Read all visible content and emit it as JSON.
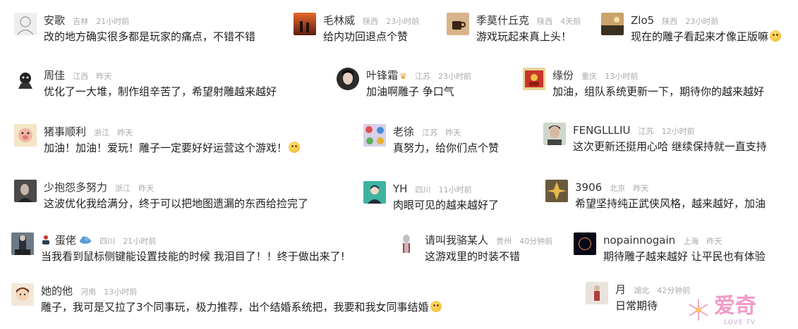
{
  "comments": [
    {
      "user": "安歌",
      "loc": "吉林",
      "time": "21小时前",
      "text": "改的地方确实很多都是玩家的痛点，不错不错",
      "avatar": "sketch-avatar"
    },
    {
      "user": "毛林威",
      "loc": "陕西",
      "time": "23小时前",
      "text": "给内功回退点个赞",
      "avatar": "sunset-couple-avatar"
    },
    {
      "user": "季莫什丘克",
      "loc": "陕西",
      "time": "4天前",
      "text": "游戏玩起来真上头！",
      "avatar": "coffee-cup-avatar"
    },
    {
      "user": "Zlo5",
      "loc": "陕西",
      "time": "23小时前",
      "text": "现在的雕子看起来才像正版嘛",
      "avatar": "landscape-avatar",
      "emoji": "wink-emoji"
    },
    {
      "user": "周佳",
      "loc": "江西",
      "time": "昨天",
      "text": "优化了一大堆，制作组辛苦了，希望射雕越来越好",
      "avatar": "cartoon-avatar"
    },
    {
      "user": "叶锋霜",
      "loc": "江苏",
      "time": "23小时前",
      "text": "加油啊雕子 争口气",
      "avatar": "portrait-avatar",
      "badge": "vip-badge-icon"
    },
    {
      "user": "缘份",
      "loc": "重庆",
      "time": "13小时前",
      "text": "加油，组队系统更新一下，期待你的越来越好",
      "avatar": "red-card-avatar"
    },
    {
      "user": "猪事顺利",
      "loc": "浙江",
      "time": "昨天",
      "text": "加油！加油！爱玩！雕子一定要好好运营这个游戏！",
      "avatar": "pig-avatar",
      "emoji": "hug-emoji"
    },
    {
      "user": "老徐",
      "loc": "江苏",
      "time": "昨天",
      "text": "真努力，给你们点个赞",
      "avatar": "pattern-avatar"
    },
    {
      "user": "FENGLLLIU",
      "loc": "江苏",
      "time": "12小时前",
      "text": "这次更新还挺用心哈 继续保持就一直支持",
      "avatar": "photo-avatar"
    },
    {
      "user": "少抱怨多努力",
      "loc": "浙江",
      "time": "昨天",
      "text": "这波优化我给满分，终于可以把地图遗漏的东西给捡完了",
      "avatar": "dark-portrait-avatar"
    },
    {
      "user": "YH",
      "loc": "四川",
      "time": "11小时前",
      "text": "肉眼可见的越来越好了",
      "avatar": "teal-character-avatar"
    },
    {
      "user": "3906",
      "loc": "北京",
      "time": "昨天",
      "text": "希望坚持纯正武侠风格，越来越好，加油",
      "avatar": "golden-avatar"
    },
    {
      "user": "蛋佬",
      "loc": "四川",
      "time": "21小时前",
      "text": "当我看到鼠标侧键能设置技能的时候 我泪目了！！终于做出来了!",
      "avatar": "warrior-avatar",
      "prefix": "person-icon",
      "suffix": "cloud-badge-icon"
    },
    {
      "user": "请叫我骆某人",
      "loc": "贵州",
      "time": "40分钟前",
      "text": "这游戏里的时装不错",
      "avatar": "ultraman-avatar"
    },
    {
      "user": "nopainnogain",
      "loc": "上海",
      "time": "昨天",
      "text": "期待雕子越来越好 让平民也有体验",
      "avatar": "eclipse-avatar"
    },
    {
      "user": "她的他",
      "loc": "河南",
      "time": "13小时前",
      "text": "雕子，我可是又拉了3个同事玩，极力推荐，出个结婚系统把，我要和我女同事结婚",
      "avatar": "cartoon-girl-avatar",
      "emoji": "laugh-emoji"
    },
    {
      "user": "月",
      "loc": "湖北",
      "time": "42分钟前",
      "text": "日常期待",
      "avatar": "figure-avatar"
    }
  ],
  "watermark": {
    "logo_text": "爱奇",
    "sub_text": "LOVE TV",
    "color": "#f29bc8"
  }
}
